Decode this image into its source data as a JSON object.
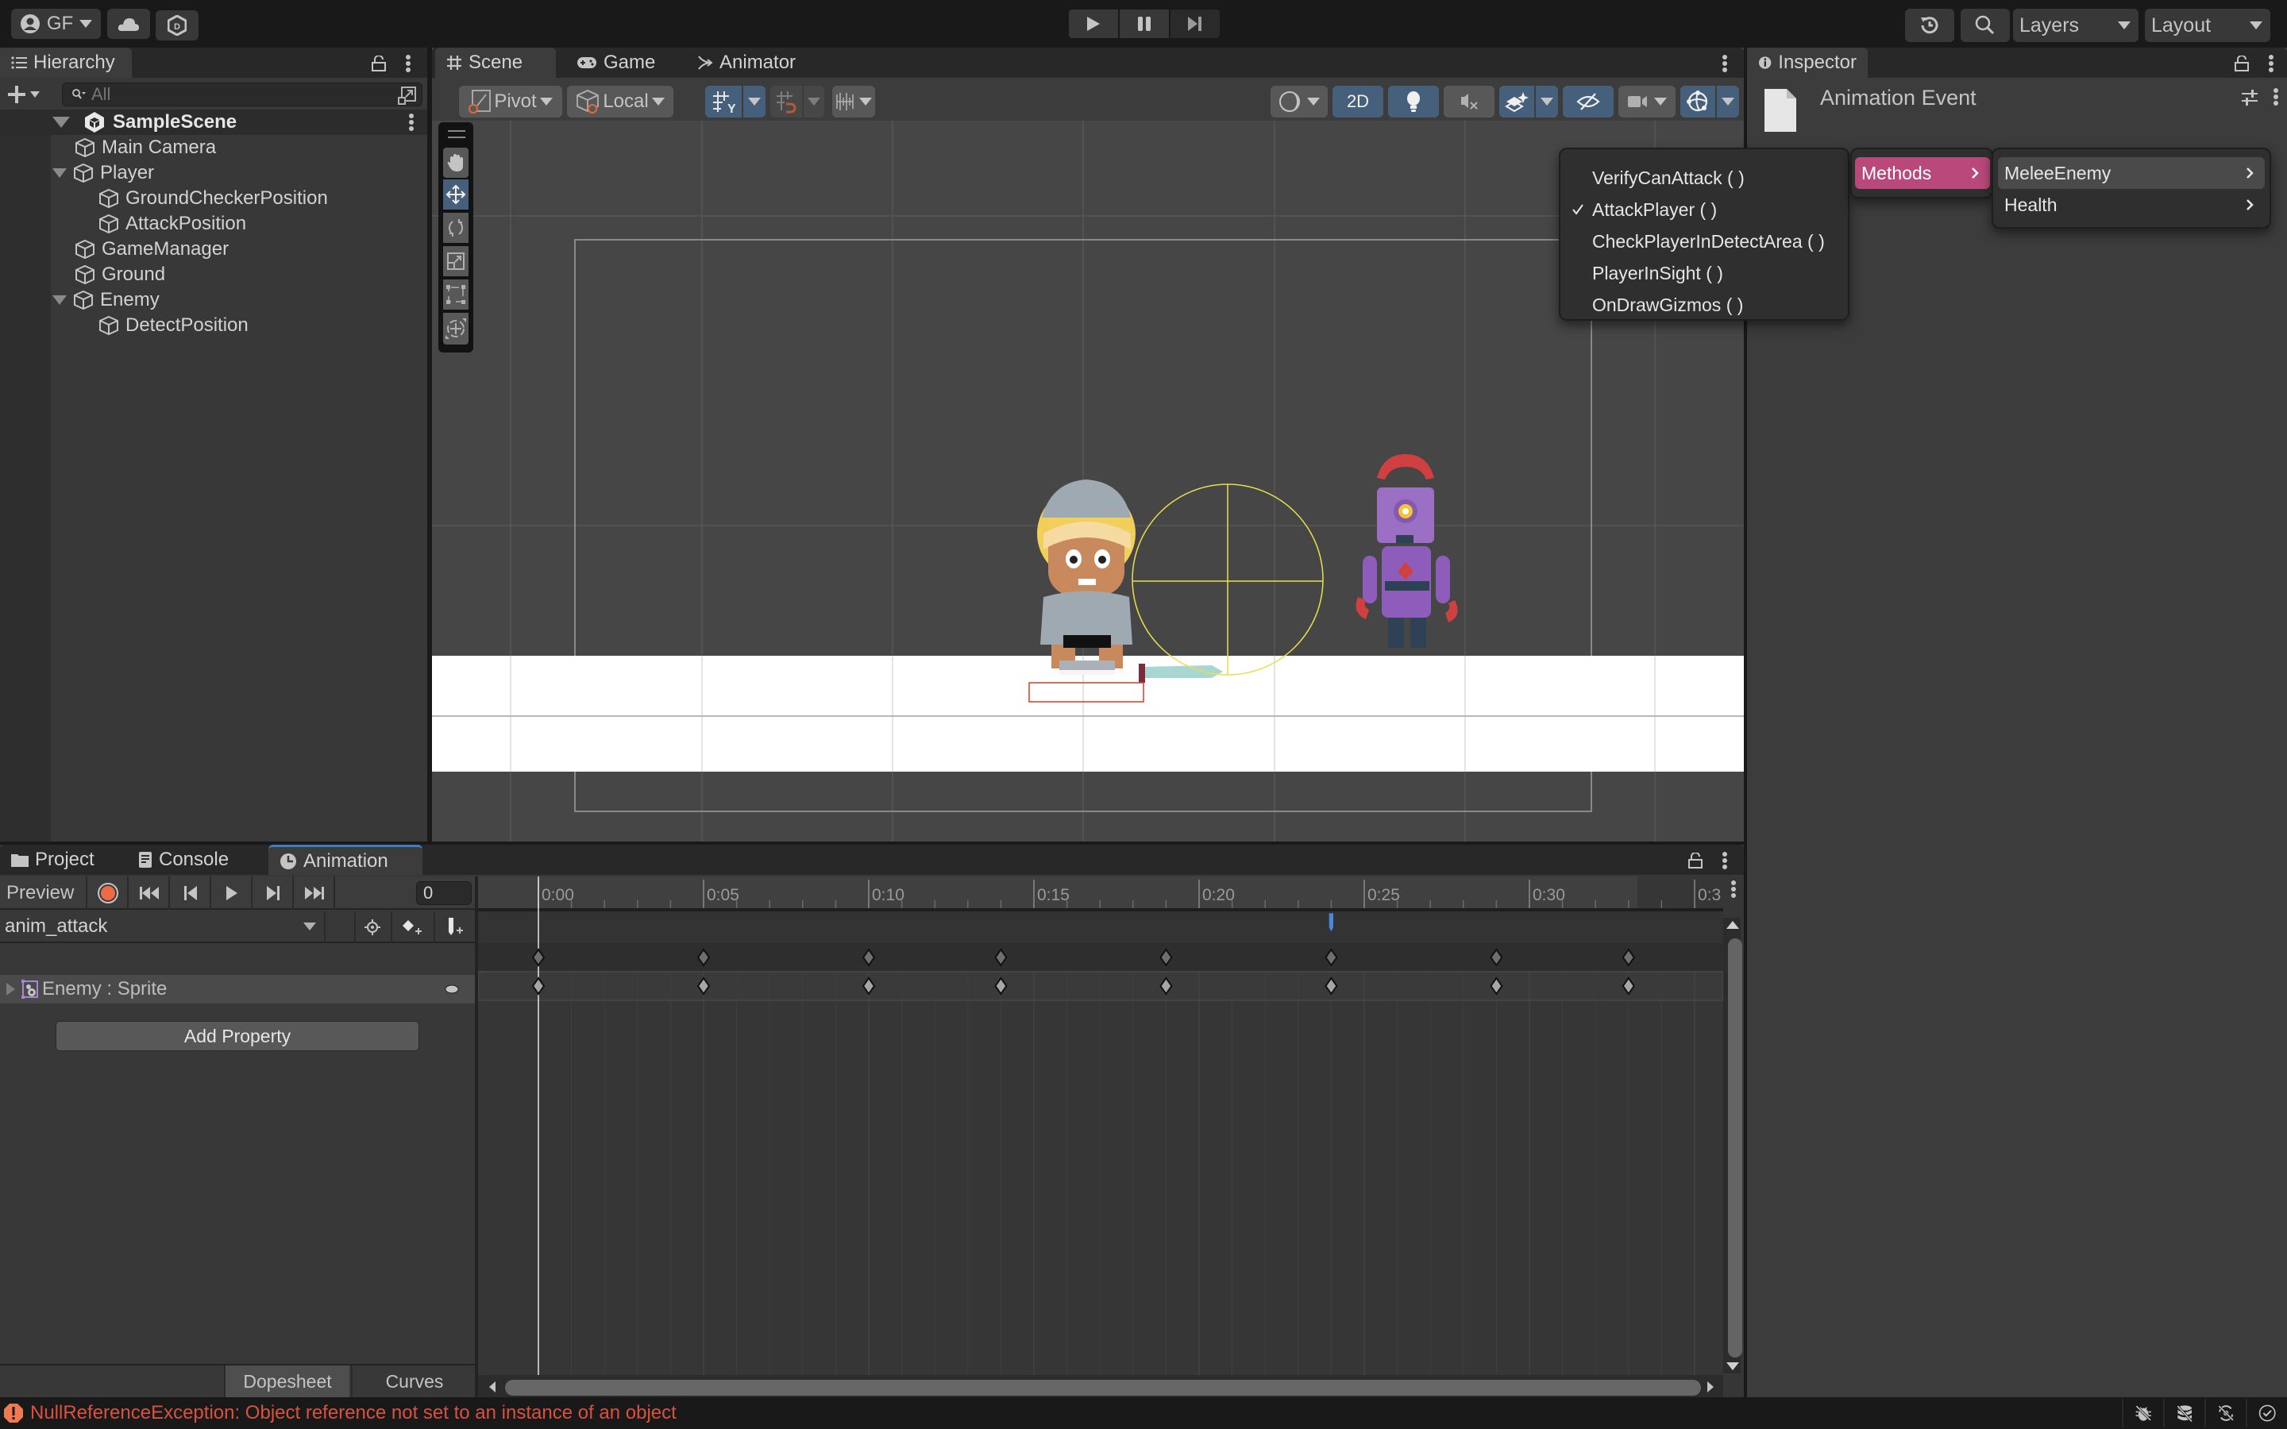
{
  "toolbar": {
    "account_label": "GF",
    "layers_label": "Layers",
    "layout_label": "Layout",
    "play_controls": [
      "play-icon",
      "pause-icon",
      "step-icon"
    ]
  },
  "hierarchy": {
    "tab_label": "Hierarchy",
    "search_placeholder": "All",
    "scene_name": "SampleScene",
    "items": [
      {
        "label": "Main Camera",
        "depth": 1,
        "expanded": null
      },
      {
        "label": "Player",
        "depth": 1,
        "expanded": true
      },
      {
        "label": "GroundCheckerPosition",
        "depth": 2,
        "expanded": null
      },
      {
        "label": "AttackPosition",
        "depth": 2,
        "expanded": null
      },
      {
        "label": "GameManager",
        "depth": 1,
        "expanded": null
      },
      {
        "label": "Ground",
        "depth": 1,
        "expanded": null
      },
      {
        "label": "Enemy",
        "depth": 1,
        "expanded": true
      },
      {
        "label": "DetectPosition",
        "depth": 2,
        "expanded": null
      }
    ]
  },
  "scene": {
    "tabs": [
      {
        "label": "Scene",
        "icon": "grid-icon",
        "active": true
      },
      {
        "label": "Game",
        "icon": "gamepad-icon",
        "active": false
      },
      {
        "label": "Animator",
        "icon": "animator-icon",
        "active": false
      }
    ],
    "pivot_label": "Pivot",
    "local_label": "Local",
    "mode_2d_label": "2D",
    "tools": [
      "hand-tool",
      "move-tool",
      "rotate-tool",
      "scale-tool",
      "rect-tool",
      "transform-tool"
    ],
    "active_tool": "move-tool"
  },
  "inspector": {
    "tab_label": "Inspector",
    "title": "Animation Event"
  },
  "context_menu": {
    "function_items": [
      {
        "label": "VerifyCanAttack ( )",
        "checked": false
      },
      {
        "label": "AttackPlayer ( )",
        "checked": true
      },
      {
        "label": "CheckPlayerInDetectArea ( )",
        "checked": false
      },
      {
        "label": "PlayerInSight ( )",
        "checked": false
      },
      {
        "label": "OnDrawGizmos ( )",
        "checked": false
      }
    ],
    "methods_label": "Methods",
    "components": [
      {
        "label": "MeleeEnemy",
        "highlighted": true
      },
      {
        "label": "Health",
        "highlighted": false
      }
    ],
    "accent_color": "#b8497a"
  },
  "bottom": {
    "tabs": [
      {
        "label": "Project",
        "icon": "folder-icon",
        "active": false
      },
      {
        "label": "Console",
        "icon": "console-icon",
        "active": false
      },
      {
        "label": "Animation",
        "icon": "clock-icon",
        "active": true
      }
    ],
    "preview_label": "Preview",
    "frame_value": "0",
    "clip_name": "anim_attack",
    "property_label": "Enemy : Sprite",
    "add_property_label": "Add Property",
    "dopesheet_label": "Dopesheet",
    "curves_label": "Curves",
    "timeline": {
      "tick_labels": [
        "0:00",
        "0:05",
        "0:10",
        "0:15",
        "0:20",
        "0:25",
        "0:30",
        "0:3"
      ],
      "keyframe_frames": [
        0,
        5,
        10,
        14,
        19,
        24,
        29,
        33
      ],
      "event_frame": 24,
      "frames_per_label": 5
    }
  },
  "status": {
    "error_text": "NullReferenceException: Object reference not set to an instance of an object",
    "error_color": "#d9523f"
  }
}
